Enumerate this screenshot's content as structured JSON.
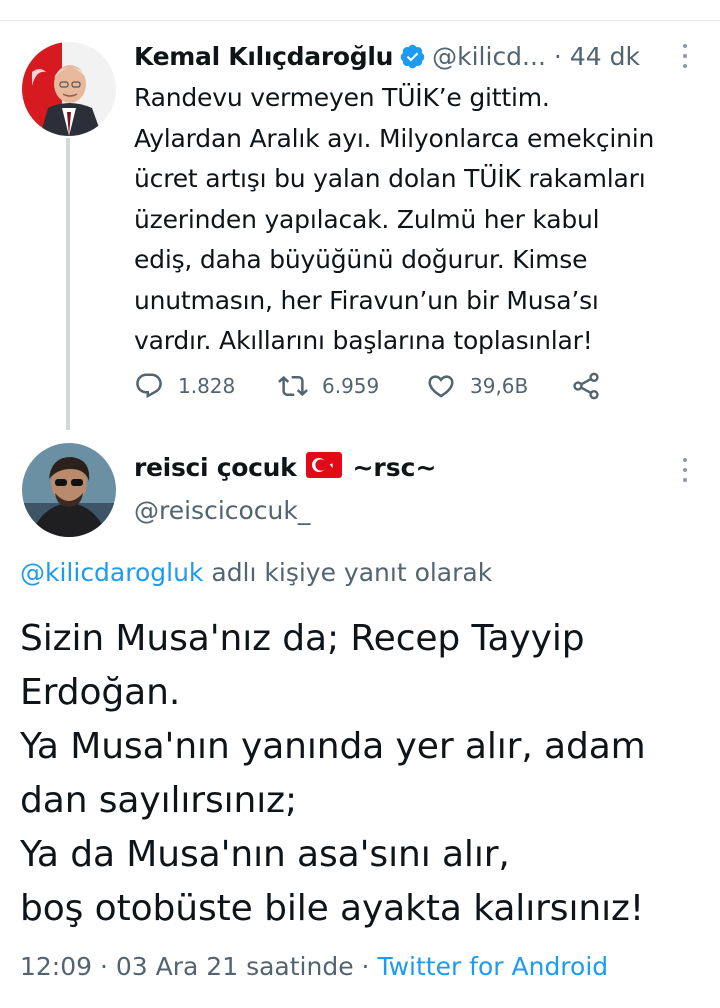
{
  "tweet1": {
    "author_name": "Kemal Kılıçdaroğlu",
    "handle": "@kilicd...",
    "separator": "·",
    "time_ago": "44 dk",
    "lines": [
      "Randevu vermeyen TÜİK’e gittim.",
      "Aylardan Aralık ayı. Milyonlarca emekçinin",
      "ücret artışı bu yalan dolan TÜİK rakamları",
      "üzerinden yapılacak. Zulmü her kabul",
      "ediş, daha büyüğünü doğurur. Kimse",
      "unutmasın, her Firavun’un bir Musa’sı",
      "vardır. Akıllarını başlarına toplasınlar!"
    ],
    "actions": {
      "replies": "1.828",
      "retweets": "6.959",
      "likes": "39,6B"
    }
  },
  "tweet2": {
    "author_name": "reisci çocuk",
    "name_suffix": "~rsc~",
    "handle": "@reiscicocuk_",
    "reply_mention": "@kilicdarogluk",
    "reply_text": " adlı kişiye yanıt olarak",
    "lines": [
      "Sizin Musa'nız da; Recep Tayyip",
      "Erdoğan.",
      "Ya Musa'nın yanında yer alır, adam",
      "dan sayılırsınız;",
      "Ya da Musa'nın asa'sını alır,",
      "boş otobüste bile ayakta kalırsınız!"
    ],
    "footer": {
      "time": "12:09",
      "sep1": "·",
      "date": "03 Ara 21 saatinde",
      "sep2": "·",
      "source": "Twitter for Android"
    }
  },
  "colors": {
    "accent": "#1d9bf0",
    "muted": "#536471",
    "text": "#0f1419",
    "flag_red": "#e30a17"
  },
  "icons": [
    "verified-icon",
    "more-icon",
    "reply-icon",
    "retweet-icon",
    "like-icon",
    "share-icon",
    "turkey-flag-icon"
  ]
}
